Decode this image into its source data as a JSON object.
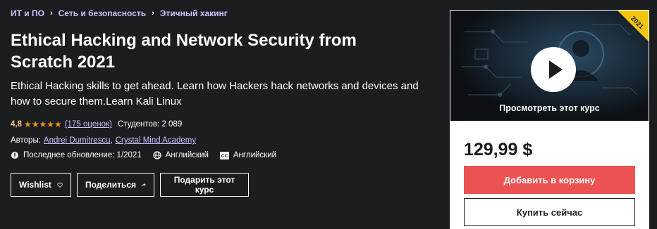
{
  "breadcrumb": {
    "items": [
      "ИТ и ПО",
      "Сеть и безопасность",
      "Этичный хакинг"
    ],
    "separator_icon": "chevron-right-icon"
  },
  "course": {
    "title": "Ethical Hacking and Network Security from Scratch 2021",
    "subtitle": "Ethical Hacking skills to get ahead. Learn how Hackers hack networks and devices and how to secure them.Learn Kali Linux",
    "rating": "4,8",
    "rating_value": 4.8,
    "stars": "★★★★★",
    "reviews": "(175 оценок)",
    "students": "Студентов: 2 089",
    "authors_label": "Авторы:",
    "authors": [
      "Andrei Dumitrescu",
      "Crystal Mind Academy"
    ],
    "last_updated": "Последнее обновление: 1/2021",
    "language": "Английский",
    "captions": "Английский"
  },
  "actions": {
    "wishlist": "Wishlist",
    "share": "Поделиться",
    "gift": "Подарить этот курс"
  },
  "sidebar": {
    "badge": "2021",
    "preview_label": "Просмотреть этот курс",
    "price": "129,99 $",
    "add_to_cart": "Добавить в корзину",
    "buy_now": "Купить сейчас"
  },
  "colors": {
    "background": "#1c1d1f",
    "link": "#cec0fc",
    "rating": "#f3ca8c",
    "stars": "#e59819",
    "cart_button": "#ec5252",
    "badge": "#f1c40f"
  }
}
